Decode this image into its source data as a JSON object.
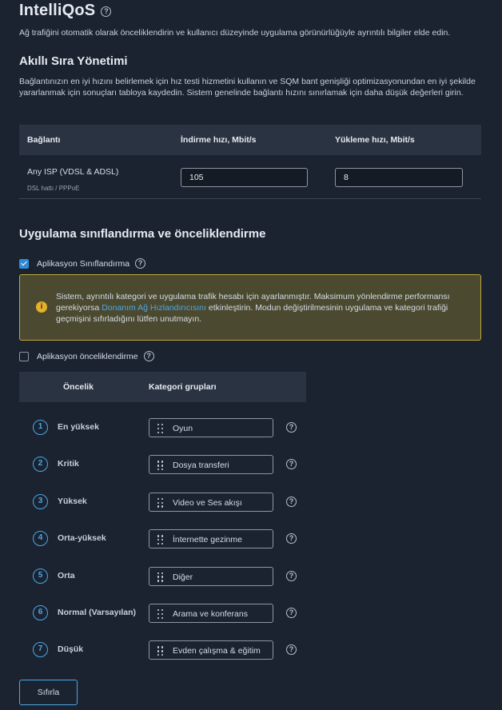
{
  "page": {
    "title": "IntelliQoS",
    "subtitle": "Ağ trafiğini otomatik olarak önceliklendirin ve kullanıcı düzeyinde uygulama görünürlüğüyle ayrıntılı bilgiler elde edin."
  },
  "sqm": {
    "heading": "Akıllı Sıra Yönetimi",
    "description": "Bağlantınızın en iyi hızını belirlemek için hız testi hizmetini kullanın ve SQM bant genişliği optimizasyonundan en iyi şekilde yararlanmak için sonuçları tabloya kaydedin. Sistem genelinde bağlantı hızını sınırlamak için daha düşük değerleri girin.",
    "columns": {
      "connection": "Bağlantı",
      "download": "İndirme hızı, Mbit/s",
      "upload": "Yükleme hızı, Mbit/s"
    },
    "row": {
      "isp": "Any ISP (VDSL & ADSL)",
      "line": "DSL hattı / PPPoE",
      "download_value": "105",
      "upload_value": "8"
    }
  },
  "app": {
    "heading": "Uygulama sınıflandırma ve önceliklendirme",
    "classification_label": "Aplikasyon Sınıflandırma",
    "classification_checked": true,
    "warning_before": "Sistem, ayrıntılı kategori ve uygulama trafik hesabı için ayarlanmıştır. Maksimum yönlendirme performansı gerekiyorsa ",
    "warning_link": "Donanım Ağ Hızlandırıcısını",
    "warning_after": " etkinleştirin. Modun değiştirilmesinin uygulama ve kategori trafiği geçmişini sıfırladığını lütfen unutmayın.",
    "prioritization_label": "Aplikasyon önceliklendirme",
    "prioritization_checked": false
  },
  "priority_table": {
    "col_priority": "Öncelik",
    "col_groups": "Kategori grupları",
    "rows": [
      {
        "num": "1",
        "label": "En yüksek",
        "group": "Oyun"
      },
      {
        "num": "2",
        "label": "Kritik",
        "group": "Dosya transferi"
      },
      {
        "num": "3",
        "label": "Yüksek",
        "group": "Video ve Ses akışı"
      },
      {
        "num": "4",
        "label": "Orta-yüksek",
        "group": "İnternette gezinme"
      },
      {
        "num": "5",
        "label": "Orta",
        "group": "Diğer"
      },
      {
        "num": "6",
        "label": "Normal (Varsayılan)",
        "group": "Arama ve konferans"
      },
      {
        "num": "7",
        "label": "Düşük",
        "group": "Evden çalışma & eğitim"
      }
    ]
  },
  "reset_label": "Sıfırla",
  "colors": {
    "background": "#1b2330",
    "accent": "#4aa8e8",
    "warning_bg": "#4b4a30",
    "warning_border": "#bfa835"
  }
}
